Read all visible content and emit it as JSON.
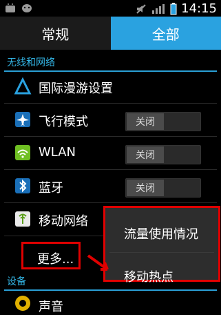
{
  "status_bar": {
    "time": "14:15",
    "icons_left": [
      "android-icon",
      "cat-icon"
    ],
    "icons_right": [
      "silent-icon",
      "signal-icon",
      "battery-icon"
    ]
  },
  "tabs": [
    {
      "label": "常规",
      "active": false
    },
    {
      "label": "全部",
      "active": true
    }
  ],
  "sections": {
    "wireless": "无线和网络",
    "device": "设备"
  },
  "rows": {
    "roaming": "国际漫游设置",
    "airplane": "飞行模式",
    "wlan": "WLAN",
    "bluetooth": "蓝牙",
    "mobile_network": "移动网络",
    "more": "更多...",
    "sound": "声音"
  },
  "toggles": {
    "off_label": "关闭"
  },
  "popup": {
    "items": [
      "流量使用情况",
      "移动热点"
    ]
  },
  "colors": {
    "accent": "#33b5e5",
    "tab_active": "#2aa2e0",
    "highlight": "#e00000",
    "background": "#000000"
  }
}
